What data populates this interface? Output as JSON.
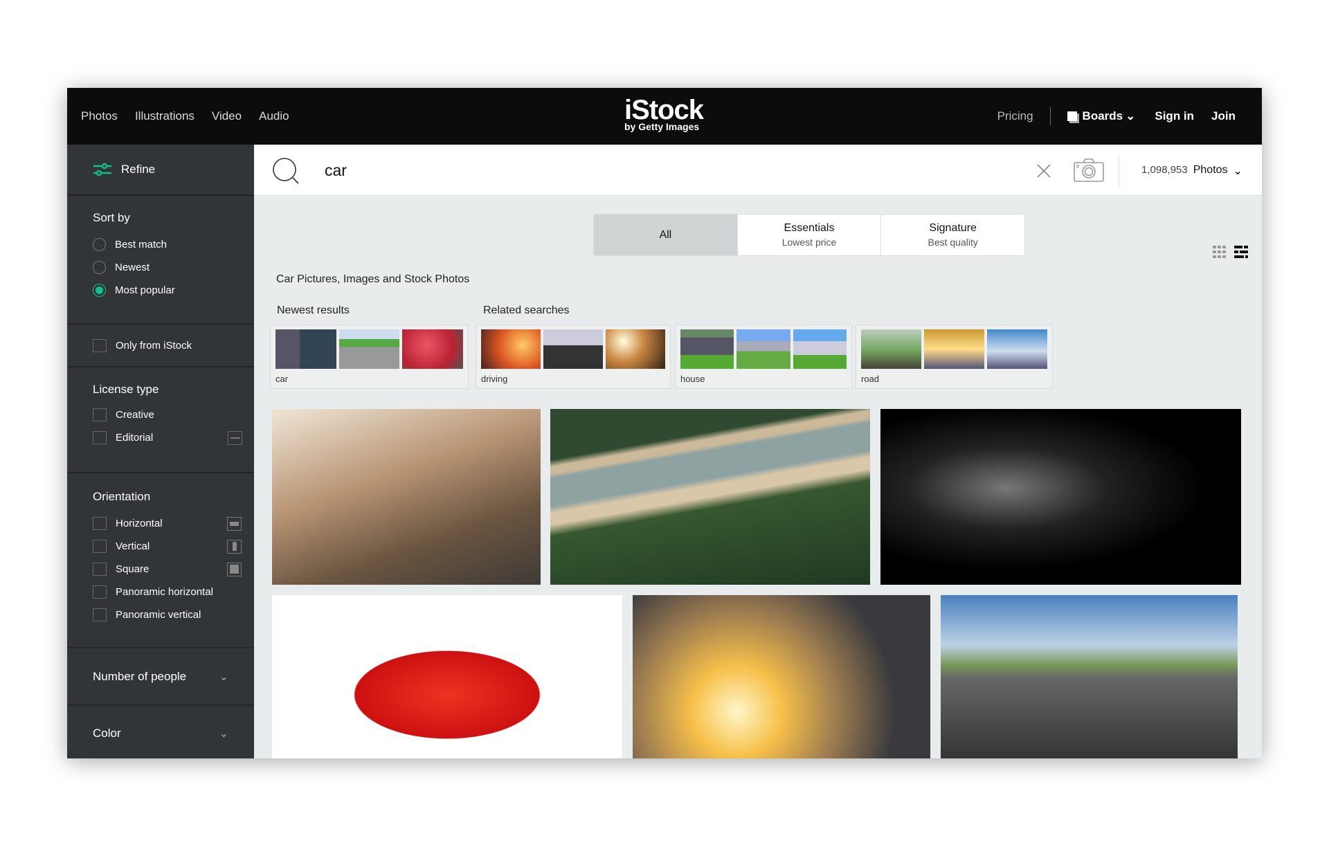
{
  "header": {
    "nav": [
      "Photos",
      "Illustrations",
      "Video",
      "Audio"
    ],
    "logo": "iStock",
    "logo_sub": "by Getty Images",
    "pricing": "Pricing",
    "boards": "Boards",
    "sign_in": "Sign in",
    "join": "Join"
  },
  "sidebar": {
    "refine": "Refine",
    "sort_by": "Sort by",
    "sort_options": [
      "Best match",
      "Newest",
      "Most popular"
    ],
    "sort_selected": "Most popular",
    "only_from": "Only from iStock",
    "license_title": "License type",
    "license": [
      "Creative",
      "Editorial"
    ],
    "orientation_title": "Orientation",
    "orientation": [
      "Horizontal",
      "Vertical",
      "Square",
      "Panoramic horizontal",
      "Panoramic vertical"
    ],
    "number_of_people": "Number of people",
    "color": "Color",
    "accent": "#0ec18f"
  },
  "search": {
    "query": "car",
    "count": "1,098,953",
    "type": "Photos"
  },
  "tabs": [
    {
      "label": "All",
      "sub": ""
    },
    {
      "label": "Essentials",
      "sub": "Lowest price"
    },
    {
      "label": "Signature",
      "sub": "Best quality"
    }
  ],
  "page_title": "Car Pictures, Images and Stock Photos",
  "newest_title": "Newest results",
  "related_title": "Related searches",
  "cards": [
    "car",
    "driving",
    "house",
    "road"
  ]
}
